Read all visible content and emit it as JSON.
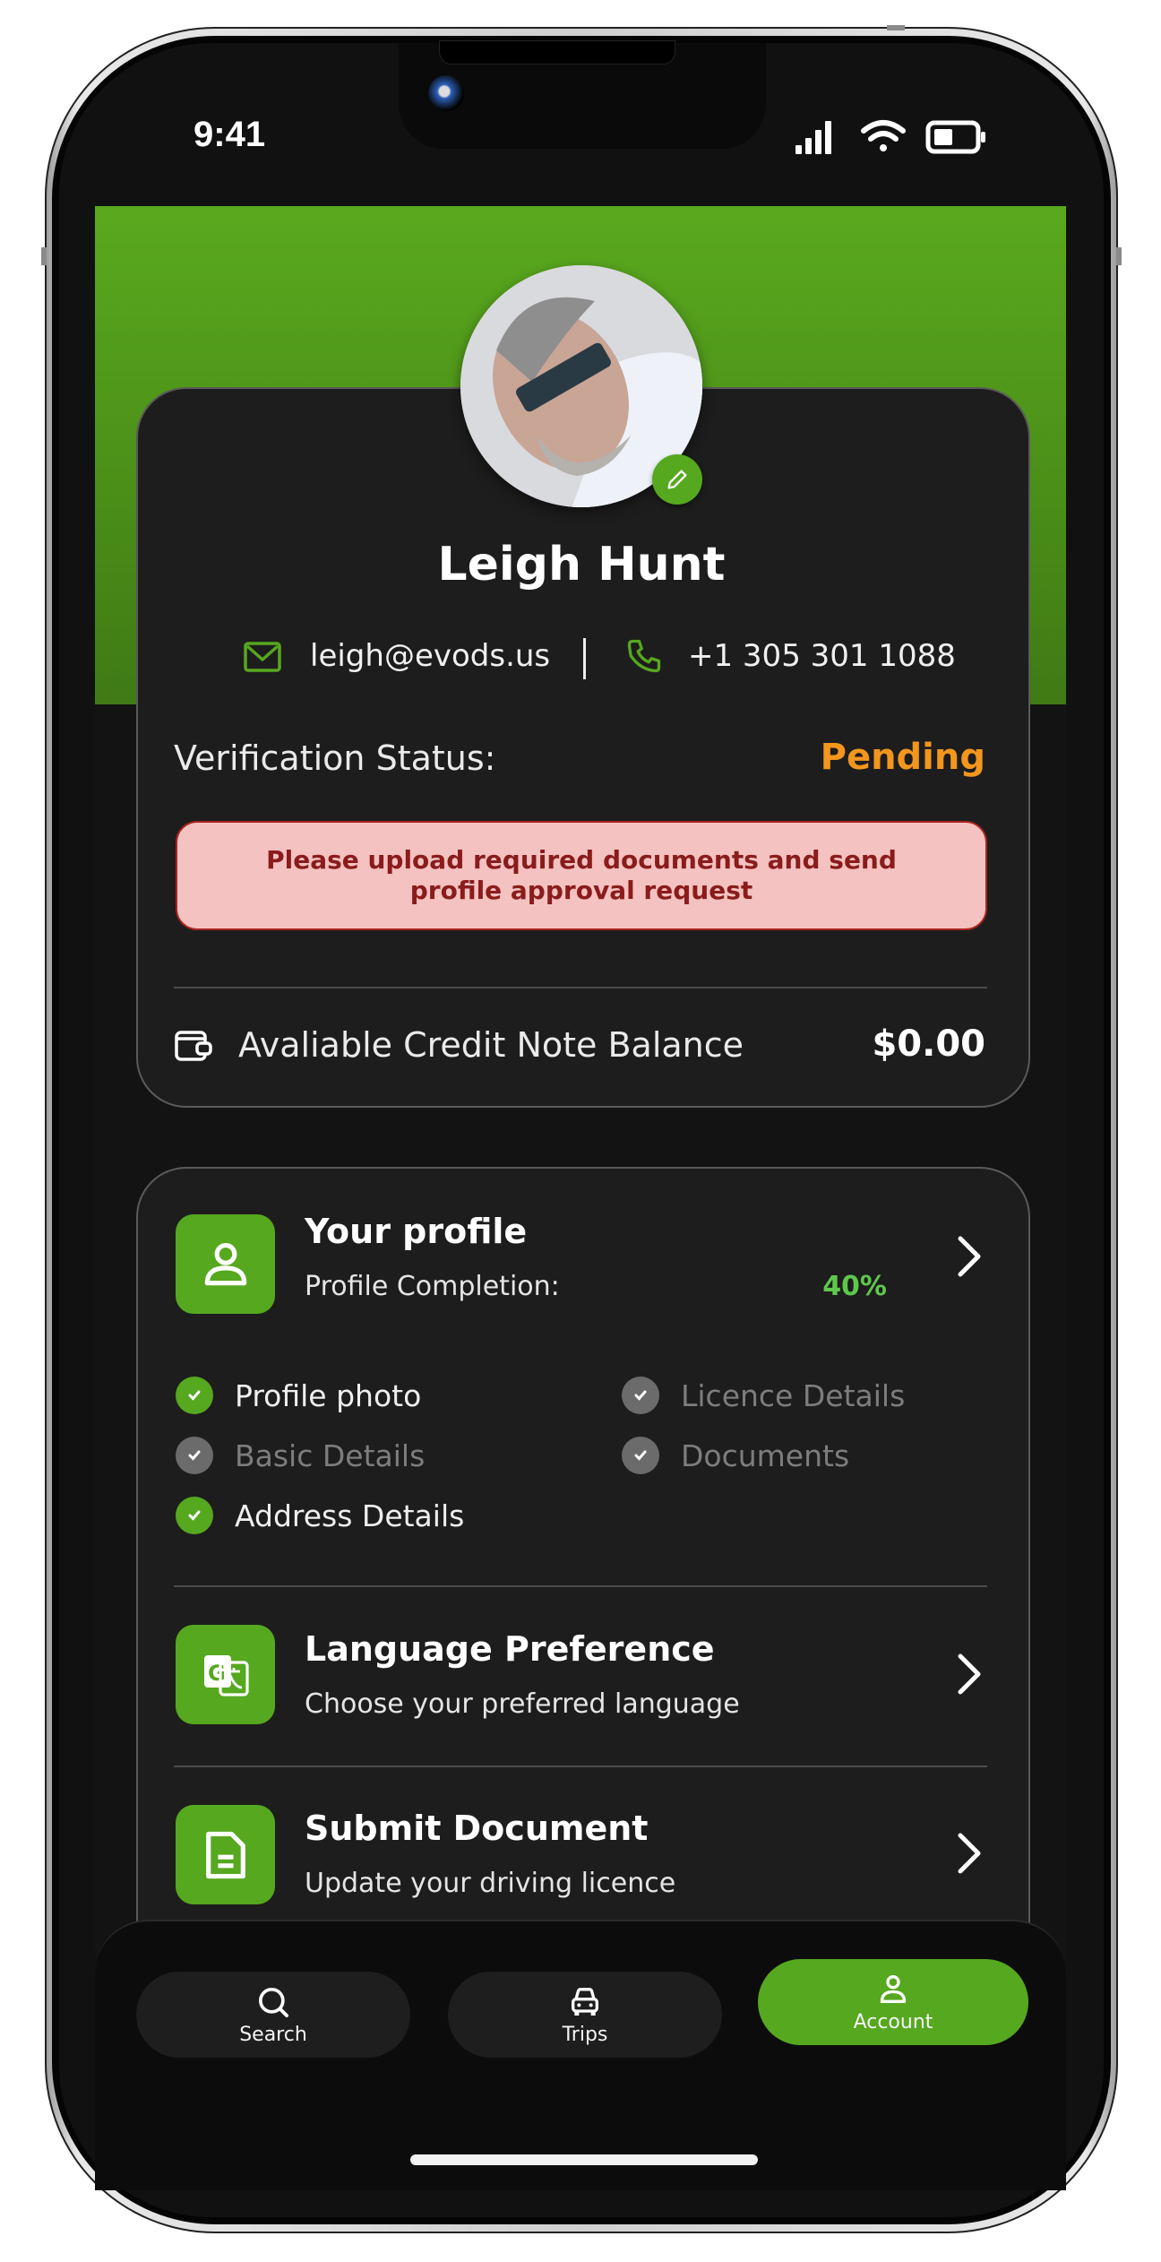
{
  "status_bar": {
    "time": "9:41",
    "icons": [
      "signal-icon",
      "wifi-icon",
      "battery-icon"
    ]
  },
  "profile_header": {
    "name": "Leigh Hunt",
    "email": "leigh@evods.us",
    "phone": "+1 305 301 1088",
    "verification_label": "Verification Status:",
    "verification_value": "Pending",
    "alert_message": "Please upload required documents and send profile approval request",
    "credit_label": "Avaliable Credit Note Balance",
    "credit_value": "$0.00"
  },
  "your_profile": {
    "title": "Your profile",
    "completion_label": "Profile Completion:",
    "completion_value": "40%",
    "completion_percent": 40,
    "checklist": [
      {
        "label": "Profile photo",
        "done": true
      },
      {
        "label": "Licence Details",
        "done": false
      },
      {
        "label": "Basic Details",
        "done": false
      },
      {
        "label": "Documents",
        "done": false
      },
      {
        "label": "Address Details",
        "done": true
      }
    ]
  },
  "menu_items": [
    {
      "title": "Language Preference",
      "subtitle": "Choose your preferred language",
      "icon": "translate-icon"
    },
    {
      "title": "Submit Document",
      "subtitle": "Update your driving licence",
      "icon": "document-icon"
    }
  ],
  "bottom_nav": {
    "tabs": [
      {
        "label": "Search",
        "icon": "search-icon",
        "active": false
      },
      {
        "label": "Trips",
        "icon": "car-icon",
        "active": false
      },
      {
        "label": "Account",
        "icon": "person-icon",
        "active": true
      }
    ]
  },
  "colors": {
    "brand_green": "#56a81f",
    "pending_orange": "#f2961e",
    "alert_bg": "#f4c2c0",
    "alert_text": "#8a1c1c",
    "percent_green": "#5ec84b"
  }
}
